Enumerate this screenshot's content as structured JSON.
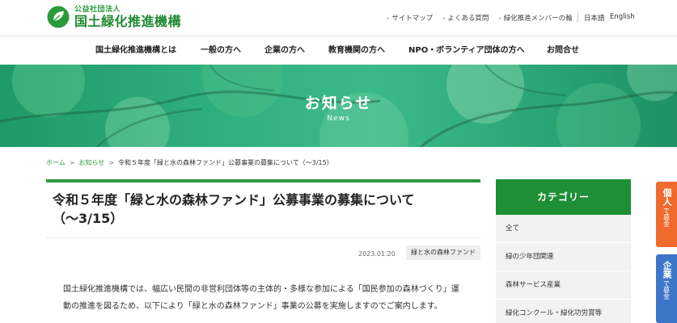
{
  "header": {
    "org_small": "公益社団法人",
    "org_name": "国土緑化推進機構",
    "util_links": [
      {
        "label": "サイトマップ"
      },
      {
        "label": "よくある質問"
      },
      {
        "label": "緑化推進メンバーの輪"
      }
    ],
    "lang_ja": "日本語",
    "lang_en": "English"
  },
  "nav": {
    "items": [
      {
        "label": "国土緑化推進機構とは"
      },
      {
        "label": "一般の方へ"
      },
      {
        "label": "企業の方へ"
      },
      {
        "label": "教育機関の方へ"
      },
      {
        "label": "NPO・ボランティア団体の方へ"
      },
      {
        "label": "お問合せ"
      }
    ]
  },
  "hero": {
    "title": "お知らせ",
    "subtitle": "News"
  },
  "breadcrumb": {
    "home": "ホーム",
    "news": "お知らせ",
    "current": "令和５年度「緑と水の森林ファンド」公募事業の募集について（〜3/15）",
    "separator": ">"
  },
  "article": {
    "title_line1": "令和５年度「緑と水の森林ファンド」公募事業の募集について",
    "title_line2": "（〜3/15）",
    "date": "2023.01.20",
    "tag": "緑と水の森林ファンド",
    "body_line1": "国土緑化推進機構では、幅広い民間の非営利団体等の主体的・多様な参加による「国民参加の森林づくり」運",
    "body_line2": "動の推進を図るため、以下により「緑と水の森林ファンド」事業の公募を実施しますのでご案内します。"
  },
  "sidebar": {
    "heading": "カテゴリー",
    "categories": [
      {
        "label": "全て"
      },
      {
        "label": "緑の少年団関連"
      },
      {
        "label": "森林サービス産業"
      },
      {
        "label": "緑化コンクール・緑化功労賞等"
      }
    ]
  },
  "side_tabs": {
    "individual_big": "個人",
    "individual_small": "で募金",
    "company_big": "企業",
    "company_small": "で募金"
  },
  "colors": {
    "brand_green": "#1e8f35",
    "accent_orange": "#ee6a2d",
    "accent_blue": "#3d76c8"
  }
}
